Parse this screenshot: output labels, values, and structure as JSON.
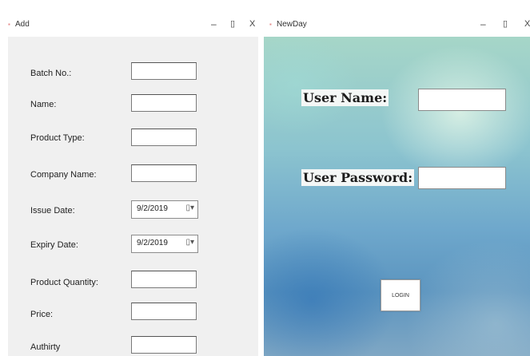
{
  "add_window": {
    "title": "Add",
    "icon": "form-icon",
    "controls": {
      "minimize": "–",
      "maximize": "▯",
      "close": "X"
    },
    "fields": [
      {
        "label": "Batch No.:",
        "value": ""
      },
      {
        "label": "Name:",
        "value": ""
      },
      {
        "label": "Product Type:",
        "value": ""
      },
      {
        "label": "Company Name:",
        "value": ""
      },
      {
        "label": "Issue Date:",
        "value": "9/2/2019"
      },
      {
        "label": "Expiry Date:",
        "value": "9/2/2019"
      },
      {
        "label": "Product Quantity:",
        "value": ""
      },
      {
        "label": "Price:",
        "value": ""
      },
      {
        "label": "Authirty",
        "value": ""
      }
    ],
    "dropdown_glyph": "▯▾"
  },
  "newday_window": {
    "title": "NewDay",
    "icon": "form-icon",
    "controls": {
      "minimize": "–",
      "maximize": "▯",
      "close": "X"
    },
    "username_label": "User Name:",
    "username_value": "",
    "password_label": "User Password:",
    "password_value": "",
    "login_button": "LOGIN"
  }
}
